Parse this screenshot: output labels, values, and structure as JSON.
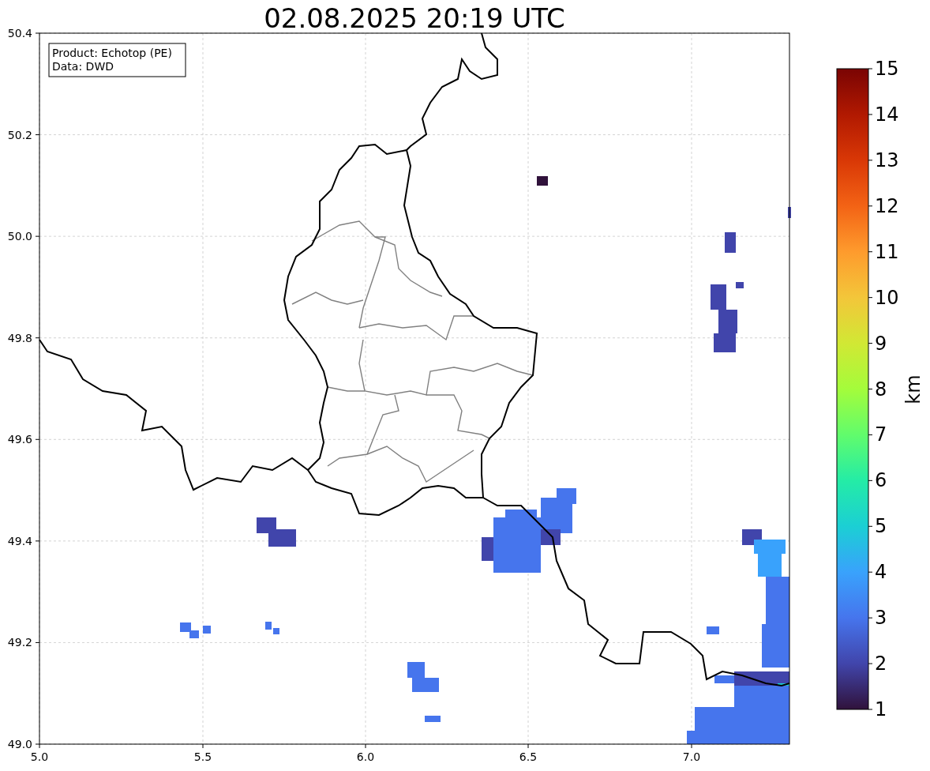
{
  "title": "02.08.2025 20:19 UTC",
  "legend": {
    "lines": [
      "Product: Echotop (PE)",
      "Data: DWD"
    ]
  },
  "map": {
    "x_ticks": [
      "5.0",
      "5.5",
      "6.0",
      "6.5",
      "7.0"
    ],
    "y_ticks": [
      "50.4",
      "50.2",
      "50.0",
      "49.8",
      "49.6",
      "49.4",
      "49.2",
      "49.0"
    ]
  },
  "colorbar": {
    "ticks": [
      "15",
      "14",
      "13",
      "12",
      "11",
      "10",
      "9",
      "8",
      "7",
      "6",
      "5",
      "4",
      "3",
      "2",
      "1"
    ],
    "label": "km"
  }
}
